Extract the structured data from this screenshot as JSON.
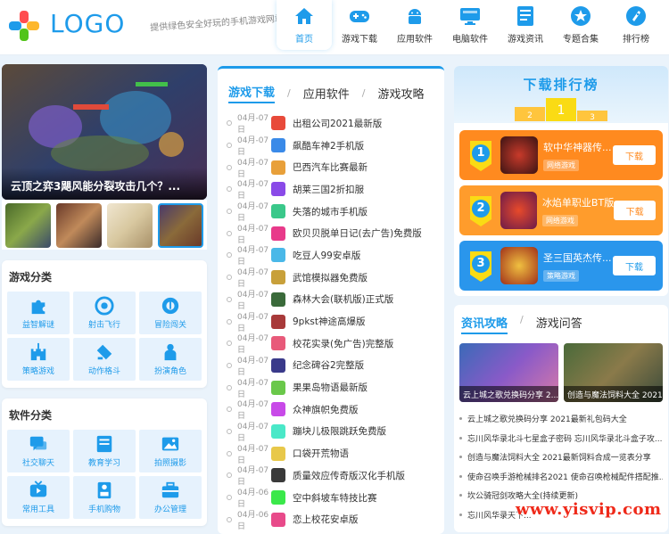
{
  "header": {
    "logo_text": "LOGO",
    "slogan": "提供绿色安全好玩的手机游戏网站",
    "nav": [
      {
        "label": "首页",
        "icon": "home-icon"
      },
      {
        "label": "游戏下载",
        "icon": "gamepad-icon"
      },
      {
        "label": "应用软件",
        "icon": "android-icon"
      },
      {
        "label": "电脑软件",
        "icon": "monitor-icon"
      },
      {
        "label": "游戏资讯",
        "icon": "document-icon"
      },
      {
        "label": "专题合集",
        "icon": "star-icon"
      },
      {
        "label": "排行榜",
        "icon": "rocket-icon"
      }
    ]
  },
  "banner": {
    "caption": "云顶之弈3飓风能分裂攻击几个？..."
  },
  "game_category": {
    "title": "游戏分类",
    "items": [
      {
        "label": "益智解谜",
        "icon": "puzzle-icon"
      },
      {
        "label": "射击飞行",
        "icon": "target-icon"
      },
      {
        "label": "冒险闯关",
        "icon": "compass-icon"
      },
      {
        "label": "策略游戏",
        "icon": "castle-icon"
      },
      {
        "label": "动作格斗",
        "icon": "sword-icon"
      },
      {
        "label": "扮演角色",
        "icon": "character-icon"
      }
    ]
  },
  "software_category": {
    "title": "软件分类",
    "items": [
      {
        "label": "社交聊天",
        "icon": "chat-icon"
      },
      {
        "label": "教育学习",
        "icon": "book-icon"
      },
      {
        "label": "拍照摄影",
        "icon": "photo-icon"
      },
      {
        "label": "常用工具",
        "icon": "tv-icon"
      },
      {
        "label": "手机购物",
        "icon": "cart-icon"
      },
      {
        "label": "办公管理",
        "icon": "briefcase-icon"
      }
    ]
  },
  "downloads": {
    "tabs": [
      "游戏下载",
      "应用软件",
      "游戏攻略"
    ],
    "items": [
      {
        "date": "04月-07日",
        "name": "出租公司2021最新版"
      },
      {
        "date": "04月-07日",
        "name": "飙酷车神2手机版"
      },
      {
        "date": "04月-07日",
        "name": "巴西汽车比赛最新"
      },
      {
        "date": "04月-07日",
        "name": "胡莱三国2折扣服"
      },
      {
        "date": "04月-07日",
        "name": "失落的城市手机版"
      },
      {
        "date": "04月-07日",
        "name": "欧贝贝脱单日记(去广告)免费版"
      },
      {
        "date": "04月-07日",
        "name": "吃豆人99安卓版"
      },
      {
        "date": "04月-07日",
        "name": "武馆模拟器免费版"
      },
      {
        "date": "04月-07日",
        "name": "森林大会(联机版)正式版"
      },
      {
        "date": "04月-07日",
        "name": "9pkst神途高爆版"
      },
      {
        "date": "04月-07日",
        "name": "校花实录(免广告)完整版"
      },
      {
        "date": "04月-07日",
        "name": "纪念碑谷2完整版"
      },
      {
        "date": "04月-07日",
        "name": "果果岛物语最新版"
      },
      {
        "date": "04月-07日",
        "name": "众神旗帜免费版"
      },
      {
        "date": "04月-07日",
        "name": "蹦块儿极限跳跃免费版"
      },
      {
        "date": "04月-07日",
        "name": "口袋开荒物语"
      },
      {
        "date": "04月-07日",
        "name": "质量效应传奇版汉化手机版"
      },
      {
        "date": "04月-06日",
        "name": "空中斜坡车特技比赛"
      },
      {
        "date": "04月-06日",
        "name": "恋上校花安卓版"
      }
    ]
  },
  "ranking": {
    "title": "下载排行榜",
    "items": [
      {
        "rank": "1",
        "name": "软中华神器传...",
        "tag": "网络游戏",
        "button": "下载"
      },
      {
        "rank": "2",
        "name": "冰焰单职业BT版",
        "tag": "网络游戏",
        "button": "下载"
      },
      {
        "rank": "3",
        "name": "圣三国英杰传...",
        "tag": "策略游戏",
        "button": "下载"
      }
    ]
  },
  "news": {
    "tabs": [
      "资讯攻略",
      "游戏问答"
    ],
    "cards": [
      {
        "caption": "云上城之歌兑换码分享 2..."
      },
      {
        "caption": "创造与魔法饲料大全 2021..."
      }
    ],
    "items": [
      "云上城之歌兑换码分享 2021最新礼包码大全",
      "忘川风华录北斗七星盒子密码 忘川风华录北斗盒子攻...",
      "创造与魔法饲料大全 2021最新饲料合成一览表分享",
      "使命召唤手游枪械排名2021 使命召唤枪械配件搭配推...",
      "坎公骑冠剑攻略大全(持续更新)",
      "忘川风华录天下..."
    ]
  },
  "watermark": "www.yisvip.com",
  "colors": {
    "accent": "#1e9bea",
    "orange": "#ff8a1f",
    "bg": "#eaf3fb"
  }
}
